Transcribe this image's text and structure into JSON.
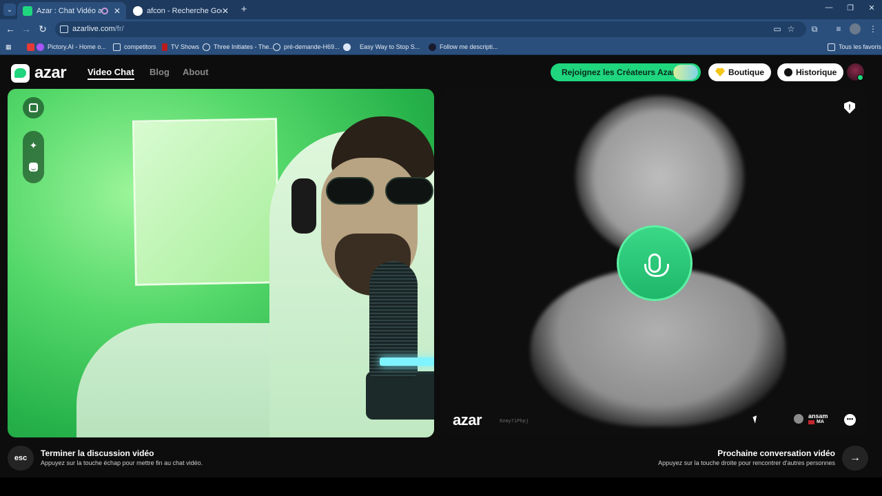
{
  "browser": {
    "tabs": [
      {
        "title": "Azar : Chat Vidéo avec de n",
        "active": true,
        "favicon_color": "#1fd67e"
      },
      {
        "title": "afcon - Recherche Google",
        "active": false,
        "favicon_color": "#ffffff"
      }
    ],
    "new_tab": "+",
    "address": {
      "domain": "azarlive.com",
      "path": "/fr/"
    },
    "bookmarks": [
      {
        "label": "Pictory.AI - Home o...",
        "icon": "pictory-icon",
        "color": "#a855f7"
      },
      {
        "label": "competitors",
        "icon": "folder-icon",
        "color": "#dbe7f5"
      },
      {
        "label": "TV Shows",
        "icon": "bookmark-icon",
        "color": "#e53935"
      },
      {
        "label": "Three Initiates - The...",
        "icon": "globe-icon",
        "color": "#dbe7f5"
      },
      {
        "label": "pré-demande-H69...",
        "icon": "globe-icon",
        "color": "#dbe7f5"
      },
      {
        "label": "Easy Way to Stop S...",
        "icon": "globe-icon",
        "color": "#dbe7f5"
      },
      {
        "label": "Follow me descripti...",
        "icon": "circle-icon",
        "color": "#1a1a2e"
      }
    ],
    "all_bookmarks": "Tous les favoris"
  },
  "header": {
    "logo_text": "azar",
    "nav": [
      "Video Chat",
      "Blog",
      "About"
    ],
    "creators_label": "Rejoignez les Créateurs Azar",
    "shop_label": "Boutique",
    "history_label": "Historique"
  },
  "remote": {
    "logo_text": "azar",
    "session_id": "8zmy7iPhpj",
    "user_name": "ansam",
    "user_country": "MA"
  },
  "actions": {
    "esc_key": "esc",
    "end_title": "Terminer la discussion vidéo",
    "end_hint": "Appuyez sur la touche échap pour mettre fin au chat vidéo.",
    "next_title": "Prochaine conversation vidéo",
    "next_hint": "Appuyez sur la touche droite pour rencontrer d'autres personnes",
    "next_key": "→"
  },
  "colors": {
    "accent_green": "#1fd67e",
    "browser_chrome": "#2b4f7c",
    "page_bg": "#0d0d0d"
  }
}
